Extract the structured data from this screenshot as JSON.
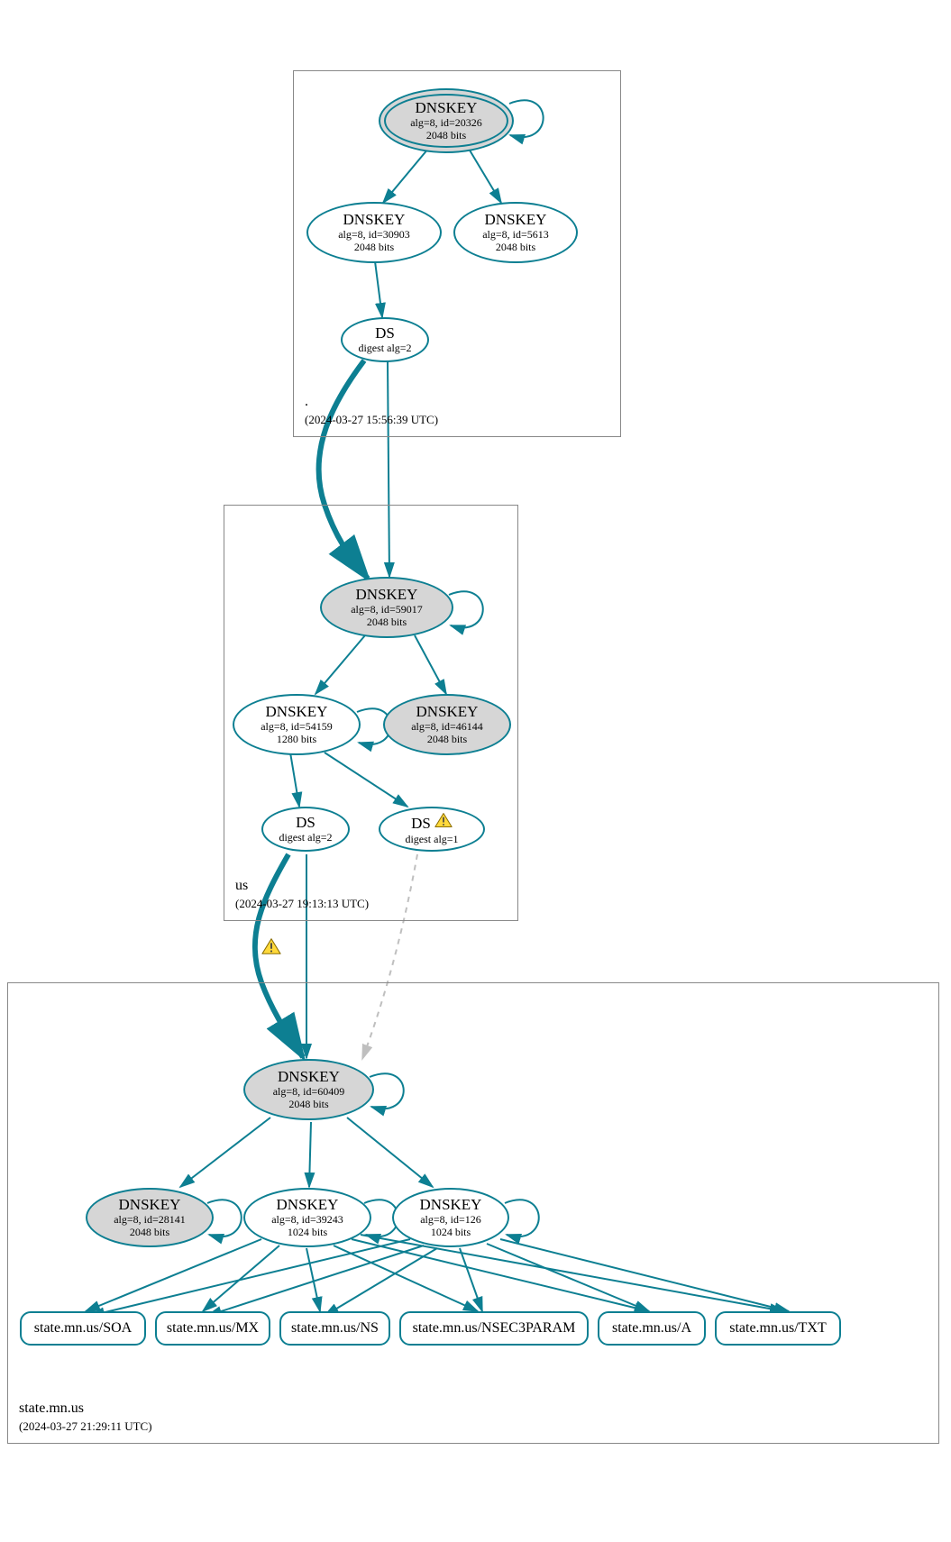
{
  "zones": {
    "root": {
      "name": ".",
      "timestamp": "(2024-03-27 15:56:39 UTC)"
    },
    "us": {
      "name": "us",
      "timestamp": "(2024-03-27 19:13:13 UTC)"
    },
    "state": {
      "name": "state.mn.us",
      "timestamp": "(2024-03-27 21:29:11 UTC)"
    }
  },
  "nodes": {
    "root_ksk": {
      "title": "DNSKEY",
      "sub1": "alg=8, id=20326",
      "sub2": "2048 bits"
    },
    "root_zsk": {
      "title": "DNSKEY",
      "sub1": "alg=8, id=30903",
      "sub2": "2048 bits"
    },
    "root_key2": {
      "title": "DNSKEY",
      "sub1": "alg=8, id=5613",
      "sub2": "2048 bits"
    },
    "root_ds": {
      "title": "DS",
      "sub1": "digest alg=2"
    },
    "us_ksk": {
      "title": "DNSKEY",
      "sub1": "alg=8, id=59017",
      "sub2": "2048 bits"
    },
    "us_zsk": {
      "title": "DNSKEY",
      "sub1": "alg=8, id=54159",
      "sub2": "1280 bits"
    },
    "us_key2": {
      "title": "DNSKEY",
      "sub1": "alg=8, id=46144",
      "sub2": "2048 bits"
    },
    "us_ds1": {
      "title": "DS",
      "sub1": "digest alg=2"
    },
    "us_ds2": {
      "title": "DS",
      "sub1": "digest alg=1"
    },
    "st_ksk": {
      "title": "DNSKEY",
      "sub1": "alg=8, id=60409",
      "sub2": "2048 bits"
    },
    "st_key_g": {
      "title": "DNSKEY",
      "sub1": "alg=8, id=28141",
      "sub2": "2048 bits"
    },
    "st_zsk1": {
      "title": "DNSKEY",
      "sub1": "alg=8, id=39243",
      "sub2": "1024 bits"
    },
    "st_zsk2": {
      "title": "DNSKEY",
      "sub1": "alg=8, id=126",
      "sub2": "1024 bits"
    }
  },
  "rr": {
    "soa": "state.mn.us/SOA",
    "mx": "state.mn.us/MX",
    "ns": "state.mn.us/NS",
    "n3p": "state.mn.us/NSEC3PARAM",
    "a": "state.mn.us/A",
    "txt": "state.mn.us/TXT"
  },
  "colors": {
    "stroke": "#0d7f92"
  }
}
